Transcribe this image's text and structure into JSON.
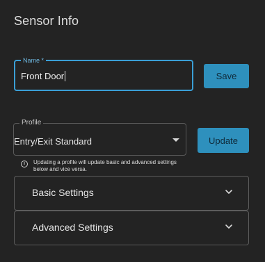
{
  "header": {
    "title": "Sensor Info"
  },
  "name_field": {
    "label": "Name *",
    "value": "Front Door"
  },
  "save_button": {
    "label": "Save"
  },
  "profile_field": {
    "label": "Profile",
    "value": "Entry/Exit Standard"
  },
  "update_button": {
    "label": "Update"
  },
  "hint": {
    "icon": "info-icon",
    "text": "Updating a profile will update basic and advanced settings below and vice versa."
  },
  "sections": {
    "basic": {
      "label": "Basic Settings",
      "icon": "chevron-down-icon"
    },
    "advanced": {
      "label": "Advanced Settings",
      "icon": "chevron-down-icon"
    }
  },
  "colors": {
    "background": "#232323",
    "accent": "#3a9fd6",
    "button": "#2e90bd"
  }
}
